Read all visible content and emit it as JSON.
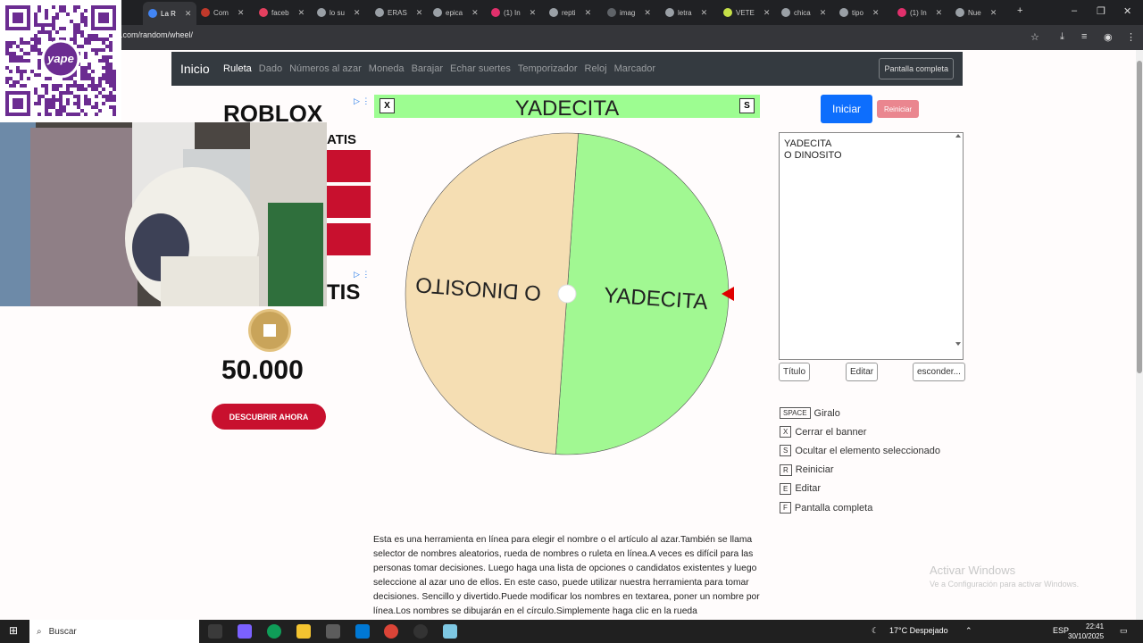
{
  "browser": {
    "tabs": [
      {
        "label": "La R",
        "active": true,
        "color": "#4285f4"
      },
      {
        "label": "Com",
        "color": "#c0392b"
      },
      {
        "label": "faceb",
        "color": "#e4405f"
      },
      {
        "label": "lo su",
        "color": "#9aa0a6"
      },
      {
        "label": "ERAS",
        "color": "#9aa0a6"
      },
      {
        "label": "epica",
        "color": "#9aa0a6"
      },
      {
        "label": "(1) In",
        "color": "#e1306c"
      },
      {
        "label": "repti",
        "color": "#9aa0a6"
      },
      {
        "label": "imag",
        "color": "#5f6368"
      },
      {
        "label": "letra",
        "color": "#9aa0a6"
      },
      {
        "label": "VETE",
        "color": "#c6e048"
      },
      {
        "label": "chica",
        "color": "#9aa0a6"
      },
      {
        "label": "tipo",
        "color": "#9aa0a6"
      },
      {
        "label": "(1) In",
        "color": "#e1306c"
      },
      {
        "label": "Nue",
        "color": "#9aa0a6"
      }
    ],
    "url": "p.com/random/wheel/"
  },
  "nav": {
    "brand": "Inicio",
    "links": [
      "Ruleta",
      "Dado",
      "Números al azar",
      "Moneda",
      "Barajar",
      "Echar suertes",
      "Temporizador",
      "Reloj",
      "Marcador"
    ],
    "fullscreen": "Pantalla completa"
  },
  "ad": {
    "title": "ROBLOX",
    "gratis1": "ATIS",
    "gratis2": "TIS",
    "amount": "50.000",
    "cta": "DESCUBRIR AHORA"
  },
  "banner": {
    "close_key": "X",
    "title": "YADECITA",
    "hide_key": "S"
  },
  "wheel": {
    "segments": [
      {
        "label": "YADECITA",
        "color": "#a1f892"
      },
      {
        "label": "O DINOSITO",
        "color": "#f5deb3"
      }
    ],
    "pointer_color": "#e00000",
    "rotation_deg": 4
  },
  "controls": {
    "start": "Iniciar",
    "reset": "Reiniciar",
    "entries_text": "YADECITA\nO DINOSITO",
    "title_btn": "Título",
    "edit_btn": "Editar",
    "hide_btn": "esconder..."
  },
  "shortcuts": [
    {
      "key": "SPACE",
      "label": "Giralo"
    },
    {
      "key": "X",
      "label": "Cerrar el banner"
    },
    {
      "key": "S",
      "label": "Ocultar el elemento seleccionado"
    },
    {
      "key": "R",
      "label": "Reiniciar"
    },
    {
      "key": "E",
      "label": "Editar"
    },
    {
      "key": "F",
      "label": "Pantalla completa"
    }
  ],
  "description": "Esta es una herramienta en línea para elegir el nombre o el artículo al azar.También se llama selector de nombres aleatorios, rueda de nombres o ruleta en línea.A veces es difícil para las personas tomar decisiones. Luego haga una lista de opciones o candidatos existentes y luego seleccione al azar uno de ellos. En este caso, puede utilizar nuestra herramienta para tomar decisiones. Sencillo y divertido.Puede modificar los nombres en textarea, poner un nombre por línea.Los nombres se dibujarán en el círculo.Simplemente haga clic en la rueda",
  "watermark": {
    "line1": "Activar Windows",
    "line2": "Ve a Configuración para activar Windows."
  },
  "overlay": {
    "qr_brand": "yape"
  },
  "taskbar": {
    "search_placeholder": "Buscar",
    "weather": "17°C Despejado",
    "lang": "ESP",
    "time": "22:41",
    "date": "30/10/2025"
  }
}
